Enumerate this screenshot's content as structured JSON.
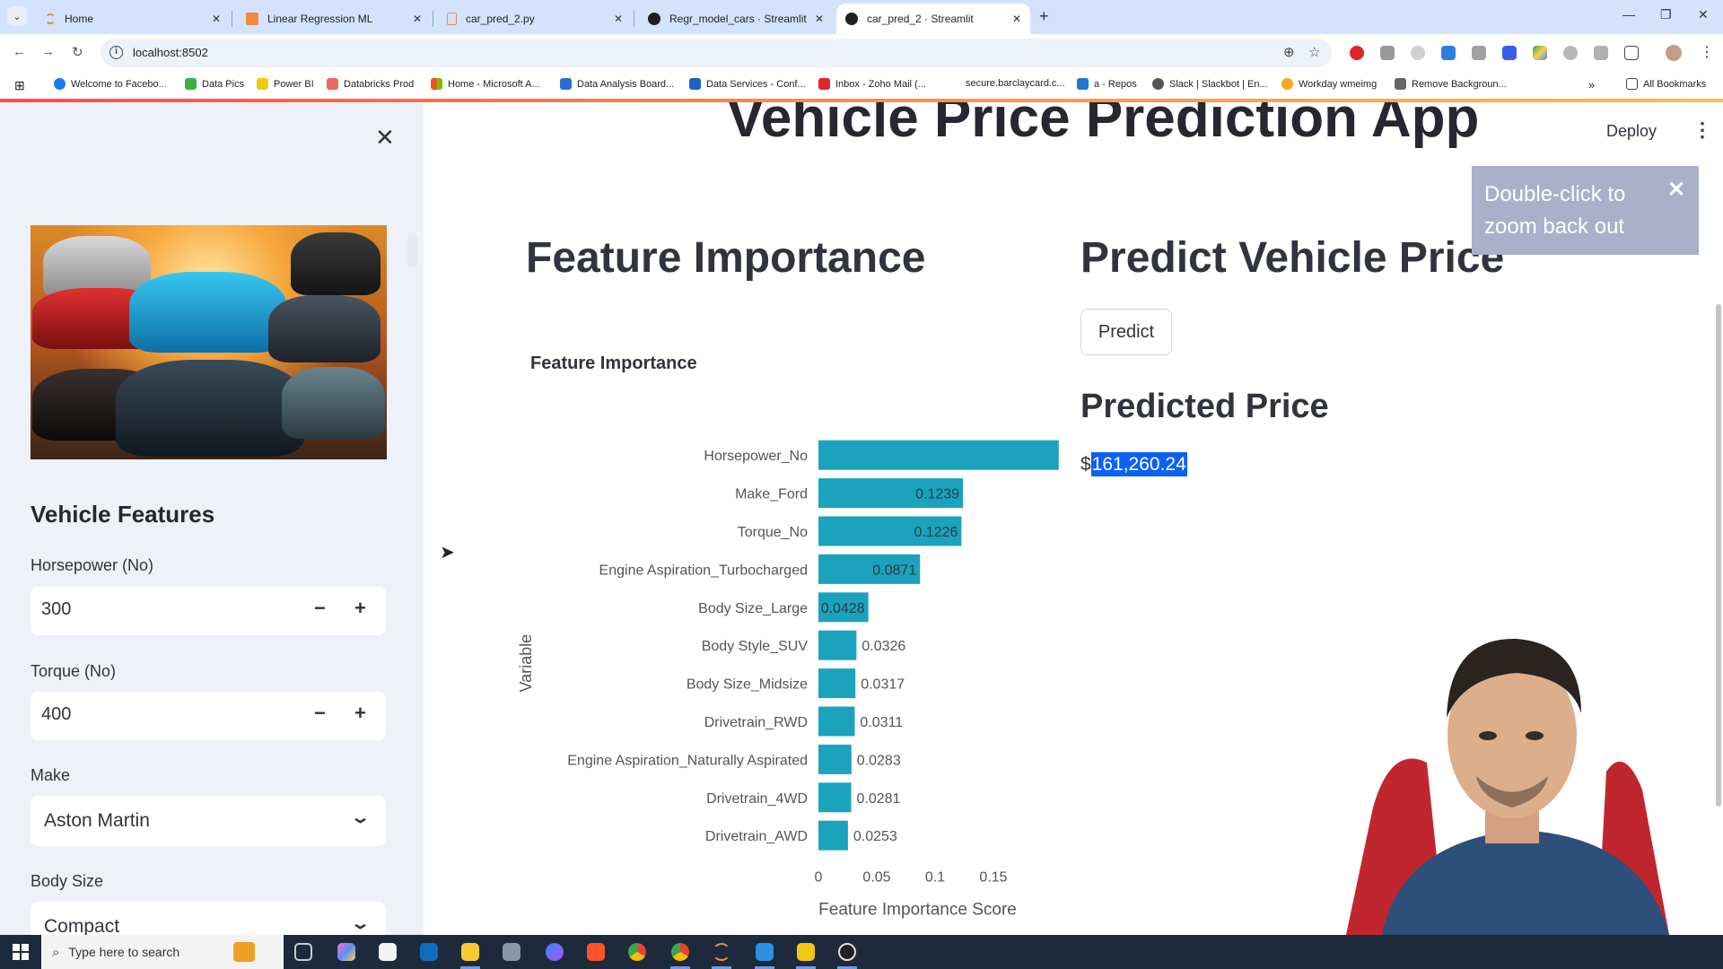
{
  "browser": {
    "tabs": [
      {
        "label": "Home",
        "favicon": "loading-icon",
        "active": false
      },
      {
        "label": "Linear Regression ML",
        "favicon": "doc-icon",
        "active": false
      },
      {
        "label": "car_pred_2.py",
        "favicon": "file-icon",
        "active": false
      },
      {
        "label": "Regr_model_cars · Streamlit",
        "favicon": "streamlit-icon",
        "active": false
      },
      {
        "label": "car_pred_2 · Streamlit",
        "favicon": "streamlit-icon",
        "active": true
      }
    ],
    "new_tab": "+",
    "url": "localhost:8502",
    "bookmarks": [
      "Welcome to Facebo...",
      "Data Pics",
      "Power BI",
      "Databricks Prod",
      "Home - Microsoft A...",
      "Data Analysis Board...",
      "Data Services - Conf...",
      "Inbox - Zoho Mail (...",
      "secure.barclaycard.c...",
      "a - Repos",
      "Slack | Slackbot | En...",
      "Workday wmeimg",
      "Remove Backgroun..."
    ],
    "bookmarks_overflow": "»",
    "all_bookmarks": "All Bookmarks"
  },
  "app": {
    "title": "Vehicle Price Prediction App",
    "deploy_label": "Deploy",
    "menu_icon": "⋮",
    "toast": {
      "text": "Double-click to zoom back out",
      "close": "✕"
    },
    "feature_importance_heading": "Feature Importance",
    "predict_heading": "Predict Vehicle Price",
    "predict_button": "Predict",
    "predicted_price_heading": "Predicted Price",
    "predicted_price_symbol": "$",
    "predicted_price_value": "161,260.24"
  },
  "sidebar": {
    "close": "✕",
    "title": "Vehicle Features",
    "fields": [
      {
        "label": "Horsepower (No)",
        "type": "number",
        "value": "300"
      },
      {
        "label": "Torque (No)",
        "type": "number",
        "value": "400"
      },
      {
        "label": "Make",
        "type": "select",
        "value": "Aston Martin"
      },
      {
        "label": "Body Size",
        "type": "select",
        "value": "Compact"
      }
    ],
    "minus": "−",
    "plus": "+",
    "chevron": "⌄"
  },
  "taskbar": {
    "search_placeholder": "Type here to search"
  },
  "chart_data": {
    "type": "bar",
    "orientation": "horizontal",
    "title": "Feature Importance",
    "xlabel": "Feature Importance Score",
    "ylabel": "Variable",
    "xlim": [
      0,
      0.2
    ],
    "xticks": [
      0,
      0.05,
      0.1,
      0.15
    ],
    "xtick_labels": [
      "0",
      "0.05",
      "0.1",
      "0.15"
    ],
    "bar_color": "#1ba3bd",
    "categories": [
      "Horsepower_No",
      "Make_Ford",
      "Torque_No",
      "Engine Aspiration_Turbocharged",
      "Body Size_Large",
      "Body Style_SUV",
      "Body Size_Midsize",
      "Drivetrain_RWD",
      "Engine Aspiration_Naturally Aspirated",
      "Drivetrain_4WD",
      "Drivetrain_AWD"
    ],
    "values": [
      0.206,
      0.1239,
      0.1226,
      0.0871,
      0.0428,
      0.0326,
      0.0317,
      0.0311,
      0.0283,
      0.0281,
      0.0253
    ],
    "value_labels": [
      "",
      "0.1239",
      "0.1226",
      "0.0871",
      "0.0428",
      "0.0326",
      "0.0317",
      "0.0311",
      "0.0283",
      "0.0281",
      "0.0253"
    ]
  }
}
